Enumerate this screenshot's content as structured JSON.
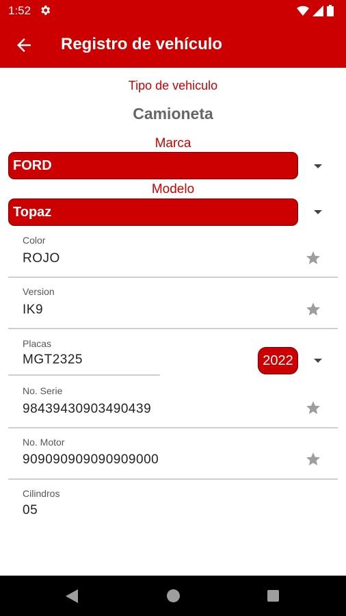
{
  "status": {
    "time": "1:52"
  },
  "app_bar": {
    "title": "Registro de vehículo"
  },
  "tipo": {
    "label": "Tipo de vehiculo",
    "value": "Camioneta"
  },
  "marca": {
    "label": "Marca",
    "value": "FORD"
  },
  "modelo": {
    "label": "Modelo",
    "value": "Topaz"
  },
  "fields": {
    "color": {
      "label": "Color",
      "value": "ROJO"
    },
    "version": {
      "label": "Version",
      "value": "IK9"
    },
    "placas": {
      "label": "Placas",
      "value": "MGT2325",
      "year": "2022"
    },
    "serie": {
      "label": "No. Serie",
      "value": "98439430903490439"
    },
    "motor": {
      "label": "No. Motor",
      "value": "909090909090909000"
    },
    "cilindros": {
      "label": "Cilindros",
      "value": "05"
    }
  },
  "colors": {
    "primary": "#cc0000",
    "star": "#9e9e9e"
  },
  "icons": {
    "back": "arrow-left-icon",
    "settings": "gear-icon",
    "favorite": "star-icon"
  }
}
